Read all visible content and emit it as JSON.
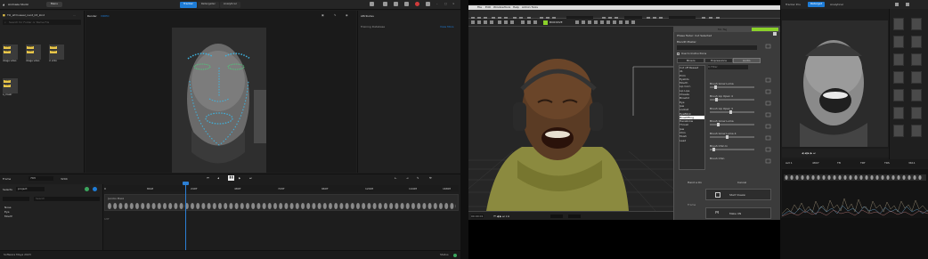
{
  "left_app": {
    "title": "Animaze Studio",
    "menu_label": "Menu",
    "tabs": [
      {
        "label": "Tracker",
        "active": true
      },
      {
        "label": "Retargeter",
        "active": false
      },
      {
        "label": "Analytical",
        "active": false
      }
    ],
    "asset_path": "TO_afrmuseel_nent_03_kind",
    "search_placeholder": "Search for Folder or Name File",
    "files": [
      {
        "badge": "Video",
        "name": "image video"
      },
      {
        "badge": "Video",
        "name": "image video"
      },
      {
        "badge": "Video",
        "name": "cl vidio"
      },
      {
        "badge": "Video",
        "name": "a_cloakr"
      }
    ],
    "render_title": "Render",
    "render_badge": "VIDEO",
    "attributes_title": "Attributes",
    "training_label": "Training Database",
    "view_more": "View More",
    "frame_label": "Frame",
    "frame_value": "793",
    "frame_end": "3204",
    "select_label": "Selects",
    "select_value": "project",
    "tree_items": [
      "Nose",
      "Eye",
      "Mouth"
    ],
    "search_label": "Search",
    "ruler_ticks": [
      "0",
      "80AT",
      "240T",
      "480T",
      "720T",
      "960T",
      "1200T",
      "1440T",
      "1680T"
    ],
    "track_label": "Jacobs Mask",
    "track_marker": "13T",
    "version": "Software Maya 2023",
    "status_label": "Status"
  },
  "mid_app": {
    "menus": [
      "File",
      "Edit",
      "Window",
      "Tools",
      "Help",
      "Admin Tools"
    ],
    "toolbar_tab": "BIODRIVE",
    "dialog_title": "Mo Tag",
    "dialog_sub": "Phase Fader: Cut Selected",
    "dialog_field": "Blendit Master",
    "dialog_check": "Use to Instructions",
    "dialog_tabs": [
      "Mixers",
      "Expressions",
      "Audio"
    ],
    "dialog_filter": "Q  Filter",
    "list_items": [
      "Cut off Reseet",
      "d1",
      "Prim",
      "Eyelids",
      "Mouth",
      "Lip Corn",
      "Lip Lips",
      "Cheeks",
      "Browlid",
      "Eye",
      "Jaw",
      "Lookat",
      "EyeBlink",
      "Browlifting",
      "Hexabrow",
      "Throat",
      "Jaw",
      "Chin",
      "Mush",
      "Lead"
    ],
    "sliders": [
      "Brush Grow Luma",
      "Brush Lip Open 4",
      "Brush Lip Open 3",
      "Brush Grow Luma",
      "Brush Grow Luma 4",
      "Brush Chin In",
      "Brush Chin"
    ],
    "dialog_bottom_left": "Hand a On",
    "dialog_bottom_right": "Cancel",
    "cmd1_label": "Start Viewer",
    "cmd2_title": "Frame",
    "cmd2_label": "Make UN",
    "viewport_bottom": "00:00:01"
  },
  "right_app": {
    "tabs": [
      {
        "label": "Tracker Pcs",
        "active": false
      },
      {
        "label": "Retarget",
        "active": true
      },
      {
        "label": "Analytical",
        "active": false
      }
    ],
    "panel_title": "Attributes",
    "ruler_ticks": [
      "Avt 1",
      "4807",
      "TM",
      "TRT",
      "TRS",
      "3611"
    ]
  },
  "colors": {
    "accent": "#1e7cd6",
    "green": "#8bd12a",
    "badge": "#e8c64a",
    "landmark": "#3fb4e0"
  }
}
